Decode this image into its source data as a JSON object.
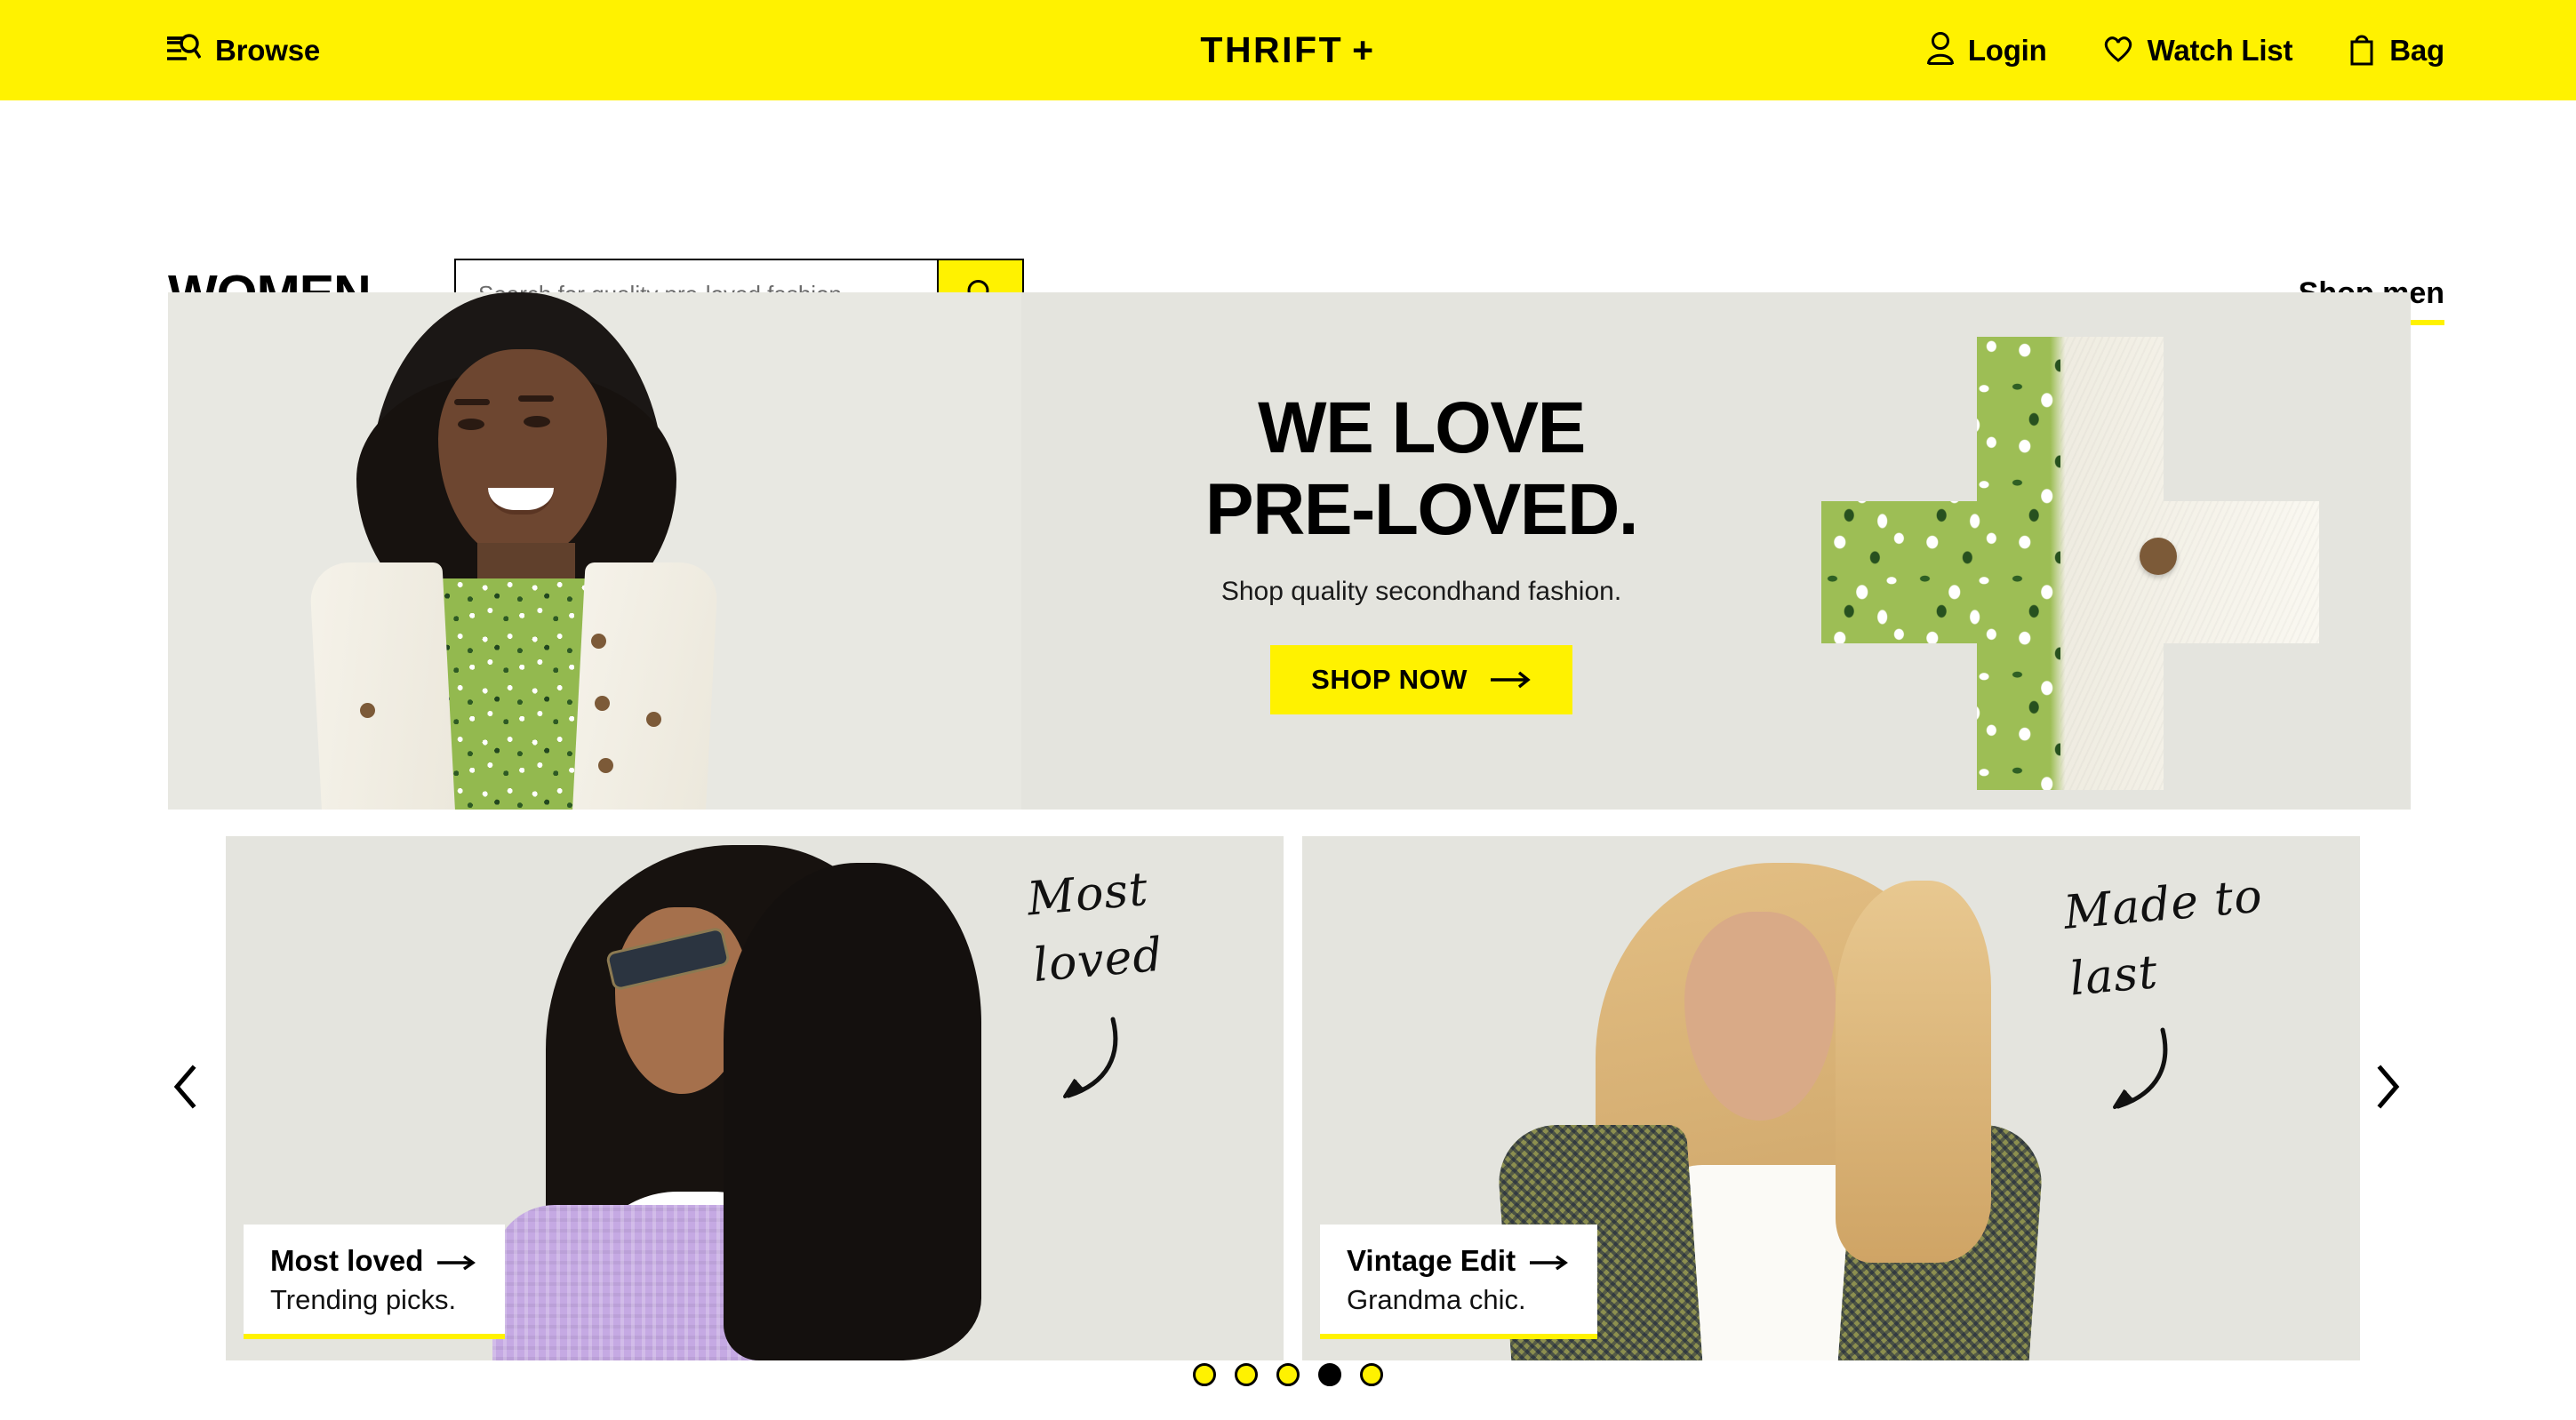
{
  "topbar": {
    "browse_label": "Browse",
    "browse_icon": "browse-lines-search-icon",
    "logo_text": "THRIFT",
    "logo_plus": "+",
    "nav": [
      {
        "label": "Login",
        "icon": "user-icon"
      },
      {
        "label": "Watch List",
        "icon": "heart-icon"
      },
      {
        "label": "Bag",
        "icon": "shopping-bag-icon"
      }
    ],
    "background_color": "#FFF200"
  },
  "subheader": {
    "section_title": "WOMEN",
    "search_placeholder": "Search for quality pre-loved fashion",
    "search_value": "",
    "search_icon": "magnifier-icon",
    "shop_men_label": "Shop men",
    "accent_color": "#FFF200"
  },
  "hero": {
    "heading_line1": "WE LOVE",
    "heading_line2": "PRE-LOVED.",
    "subheading": "Shop quality secondhand fashion.",
    "cta_label": "SHOP NOW",
    "cta_arrow": "→",
    "background_color": "#E4E4DE",
    "image_alt_left": "woman in white denim jacket and green floral dress",
    "image_alt_right": "plus-shaped crop of green floral fabric and white denim with brown button"
  },
  "carousel": {
    "prev_icon": "chevron-left-icon",
    "next_icon": "chevron-right-icon",
    "cards": [
      {
        "script_line1": "Most",
        "script_line2": "loved",
        "title": "Most loved",
        "arrow": "→",
        "subtitle": "Trending picks.",
        "image_alt": "woman with long curly dark hair, sunglasses and lilac knit sweater"
      },
      {
        "script_line1": "Made to",
        "script_line2": "last",
        "title": "Vintage Edit",
        "arrow": "→",
        "subtitle": "Grandma chic.",
        "image_alt": "blonde woman in houndstooth blazer over white shirt"
      }
    ],
    "dots": [
      {
        "active": false
      },
      {
        "active": false
      },
      {
        "active": false
      },
      {
        "active": true
      },
      {
        "active": false
      }
    ]
  }
}
